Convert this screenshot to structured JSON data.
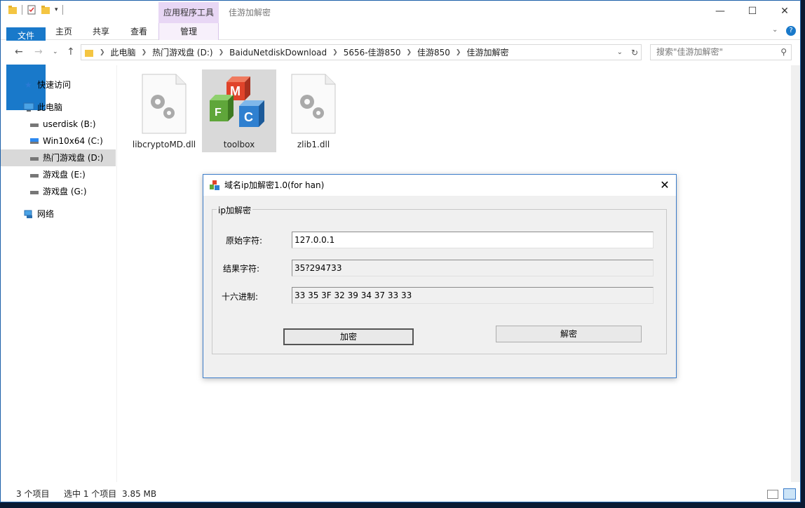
{
  "explorer": {
    "ribbon": {
      "context_group": "应用程序工具",
      "tabs": [
        "文件",
        "主页",
        "共享",
        "查看"
      ],
      "manage_tab": "管理"
    },
    "window_title": "佳游加解密",
    "breadcrumbs": [
      "此电脑",
      "热门游戏盘 (D:)",
      "BaiduNetdiskDownload",
      "5656-佳游850",
      "佳游850",
      "佳游加解密"
    ],
    "search_placeholder": "搜索\"佳游加解密\"",
    "nav": {
      "quick_access": "快速访问",
      "this_pc": "此电脑",
      "drives": [
        "userdisk (B:)",
        "Win10x64 (C:)",
        "热门游戏盘 (D:)",
        "游戏盘 (E:)",
        "游戏盘 (G:)"
      ],
      "network": "网络"
    },
    "files": [
      "libcryptoMD.dll",
      "toolbox",
      "zlib1.dll"
    ],
    "status": {
      "count": "3 个项目",
      "selection": "选中 1 个项目",
      "size": "3.85 MB"
    }
  },
  "dialog": {
    "title": "域名ip加解密1.0(for han)",
    "group_label": "ip加解密",
    "labels": {
      "original": "原始字符:",
      "result": "结果字符:",
      "hex": "十六进制:"
    },
    "values": {
      "original": "127.0.0.1",
      "result": "35?294733",
      "hex": "33 35 3F 32 39 34 37 33 33"
    },
    "buttons": {
      "encrypt": "加密",
      "decrypt": "解密"
    }
  },
  "colors": {
    "file_tab": "#1979ca",
    "context_tab": "#e8d7f5",
    "dialog_border": "#3b7cc9",
    "selection": "#d9d9d9"
  }
}
